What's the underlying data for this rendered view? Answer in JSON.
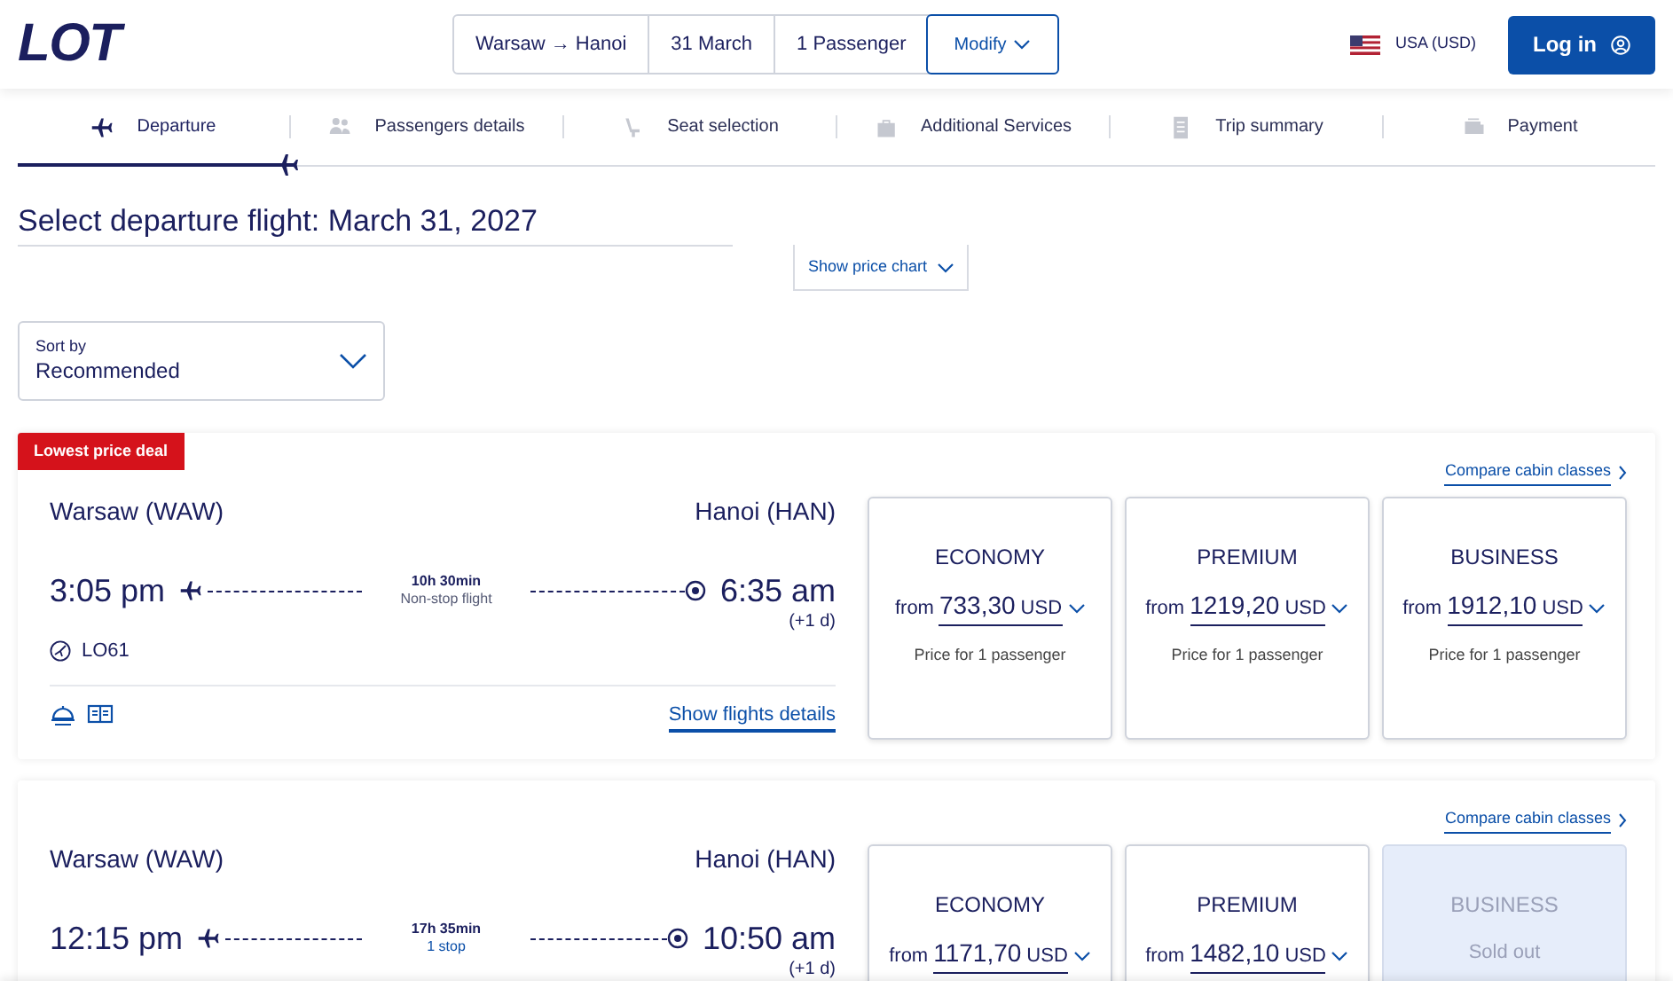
{
  "header": {
    "logo": "LOT",
    "search": {
      "route": "Warsaw → Hanoi",
      "date": "31 March",
      "passengers": "1 Passenger",
      "modify": "Modify"
    },
    "locale": "USA (USD)",
    "login": "Log in"
  },
  "steps": [
    {
      "label": "Departure",
      "selected": true
    },
    {
      "label": "Passengers details",
      "selected": false
    },
    {
      "label": "Seat selection",
      "selected": false
    },
    {
      "label": "Additional Services",
      "selected": false
    },
    {
      "label": "Trip summary",
      "selected": false
    },
    {
      "label": "Payment",
      "selected": false
    }
  ],
  "title": "Select departure flight: March 31, 2027",
  "price_chart_button": "Show price chart",
  "sort": {
    "label": "Sort by",
    "value": "Recommended"
  },
  "flights": [
    {
      "badge": "Lowest price deal",
      "compare_link": "Compare cabin classes",
      "from": "Warsaw (WAW)",
      "to": "Hanoi (HAN)",
      "depart": "3:05 pm",
      "arrive": "6:35 am",
      "day_offset": "(+1 d)",
      "duration": "10h 30min",
      "stops": "Non-stop flight",
      "direct": true,
      "flight_number": "LO61",
      "details_link": "Show flights details",
      "fares": [
        {
          "cabin": "ECONOMY",
          "prefix": "from",
          "price": "733,30",
          "currency": "USD",
          "note": "Price for 1 passenger",
          "sold_out": false
        },
        {
          "cabin": "PREMIUM",
          "prefix": "from",
          "price": "1219,20",
          "currency": "USD",
          "note": "Price for 1 passenger",
          "sold_out": false
        },
        {
          "cabin": "BUSINESS",
          "prefix": "from",
          "price": "1912,10",
          "currency": "USD",
          "note": "Price for 1 passenger",
          "sold_out": false
        }
      ]
    },
    {
      "compare_link": "Compare cabin classes",
      "from": "Warsaw (WAW)",
      "to": "Hanoi (HAN)",
      "depart": "12:15 pm",
      "arrive": "10:50 am",
      "day_offset": "(+1 d)",
      "duration": "17h 35min",
      "stops": "1 stop",
      "direct": false,
      "fares": [
        {
          "cabin": "ECONOMY",
          "prefix": "from",
          "price": "1171,70",
          "currency": "USD",
          "sold_out": false
        },
        {
          "cabin": "PREMIUM",
          "prefix": "from",
          "price": "1482,10",
          "currency": "USD",
          "sold_out": false
        },
        {
          "cabin": "BUSINESS",
          "note": "Sold out",
          "sold_out": true
        }
      ]
    }
  ]
}
